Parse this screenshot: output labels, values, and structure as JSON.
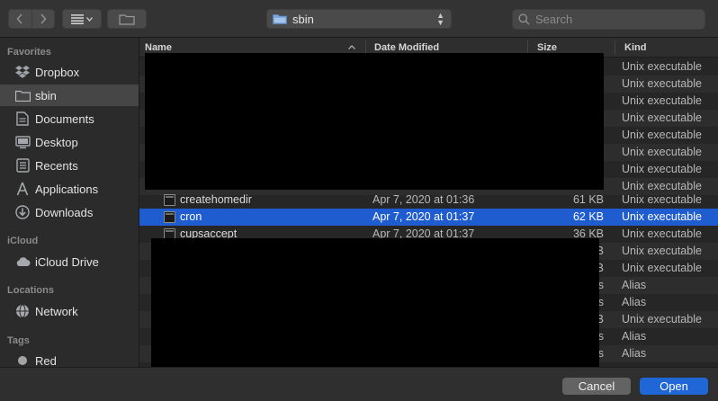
{
  "toolbar": {
    "back_icon": "chevron-left-icon",
    "forward_icon": "chevron-right-icon",
    "view_icon": "list-view-icon",
    "new_folder_icon": "folder-icon",
    "path_popup_label": "sbin",
    "search_placeholder": "Search"
  },
  "sidebar": {
    "sections": [
      {
        "heading": "Favorites",
        "items": [
          {
            "label": "Dropbox",
            "icon": "dropbox-icon"
          },
          {
            "label": "sbin",
            "icon": "folder-icon",
            "selected": true
          },
          {
            "label": "Documents",
            "icon": "document-icon"
          },
          {
            "label": "Desktop",
            "icon": "desktop-icon"
          },
          {
            "label": "Recents",
            "icon": "recents-icon"
          },
          {
            "label": "Applications",
            "icon": "applications-icon"
          },
          {
            "label": "Downloads",
            "icon": "downloads-icon"
          }
        ]
      },
      {
        "heading": "iCloud",
        "items": [
          {
            "label": "iCloud Drive",
            "icon": "cloud-icon"
          }
        ]
      },
      {
        "heading": "Locations",
        "items": [
          {
            "label": "Network",
            "icon": "globe-icon"
          }
        ]
      },
      {
        "heading": "Tags",
        "items": [
          {
            "label": "Red",
            "icon": "tag-dot-icon"
          }
        ]
      }
    ]
  },
  "columns": {
    "name": "Name",
    "date": "Date Modified",
    "size": "Size",
    "kind": "Kind"
  },
  "rows": [
    {
      "name": "",
      "date": "",
      "size": "",
      "kind": "Unix executable"
    },
    {
      "name": "",
      "date": "",
      "size": "",
      "kind": "Unix executable"
    },
    {
      "name": "",
      "date": "",
      "size": "",
      "kind": "Unix executable"
    },
    {
      "name": "",
      "date": "",
      "size": "",
      "kind": "Unix executable"
    },
    {
      "name": "",
      "date": "",
      "size": "",
      "kind": "Unix executable"
    },
    {
      "name": "",
      "date": "",
      "size": "",
      "kind": "Unix executable"
    },
    {
      "name": "",
      "date": "",
      "size": "",
      "kind": "Unix executable"
    },
    {
      "name": "",
      "date": "",
      "size": "",
      "kind": "Unix executable"
    },
    {
      "name": "createhomedir",
      "date": "Apr 7, 2020 at 01:36",
      "size": "61 KB",
      "kind": "Unix executable"
    },
    {
      "name": "cron",
      "date": "Apr 7, 2020 at 01:37",
      "size": "62 KB",
      "kind": "Unix executable",
      "selected": true
    },
    {
      "name": "cupsaccept",
      "date": "Apr 7, 2020 at 01:37",
      "size": "36 KB",
      "kind": "Unix executable"
    },
    {
      "name": "",
      "date": "",
      "size": "B",
      "kind": "Unix executable"
    },
    {
      "name": "",
      "date": "",
      "size": "B",
      "kind": "Unix executable"
    },
    {
      "name": "",
      "date": "",
      "size": "s",
      "kind": "Alias"
    },
    {
      "name": "",
      "date": "",
      "size": "s",
      "kind": "Alias"
    },
    {
      "name": "",
      "date": "",
      "size": "B",
      "kind": "Unix executable"
    },
    {
      "name": "",
      "date": "",
      "size": "s",
      "kind": "Alias"
    },
    {
      "name": "",
      "date": "",
      "size": "s",
      "kind": "Alias"
    }
  ],
  "buttons": {
    "cancel": "Cancel",
    "open": "Open"
  },
  "colors": {
    "selection": "#1f5cd0",
    "primary_button": "#1f66d6",
    "background": "#262626"
  }
}
